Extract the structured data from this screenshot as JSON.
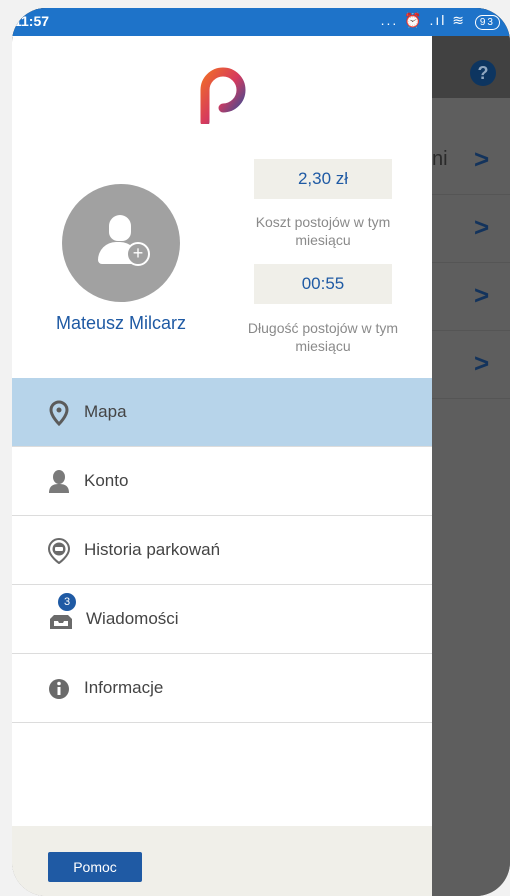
{
  "status_bar": {
    "time": "11:57",
    "indicators": "... ⏰ .ıl ≋",
    "battery": "93"
  },
  "background": {
    "help_icon": "?",
    "rows": [
      {
        "partial_text": "ni",
        "chevron": ">"
      },
      {
        "partial_text": "",
        "chevron": ">"
      },
      {
        "partial_text": "",
        "chevron": ">"
      },
      {
        "partial_text": "",
        "chevron": ">"
      }
    ]
  },
  "drawer": {
    "logo_icon": "p-logo-icon",
    "user": {
      "name": "Mateusz Milcarz",
      "avatar_icon": "user-add-icon"
    },
    "stats": [
      {
        "value": "2,30 zł",
        "label": "Koszt postojów w tym miesiącu"
      },
      {
        "value": "00:55",
        "label": "Długość postojów w tym miesiącu"
      }
    ],
    "menu": [
      {
        "label": "Mapa",
        "icon": "map-pin-icon",
        "active": true
      },
      {
        "label": "Konto",
        "icon": "person-icon",
        "active": false
      },
      {
        "label": "Historia parkowań",
        "icon": "car-pin-icon",
        "active": false
      },
      {
        "label": "Wiadomości",
        "icon": "inbox-icon",
        "badge": "3",
        "active": false
      },
      {
        "label": "Informacje",
        "icon": "info-icon",
        "active": false
      }
    ],
    "footer": {
      "help_button": "Pomoc"
    }
  },
  "colors": {
    "accent": "#1f5aa4",
    "status_bar": "#1e73c9",
    "active_row": "#b7d4ea",
    "footer": "#f0efe9"
  }
}
